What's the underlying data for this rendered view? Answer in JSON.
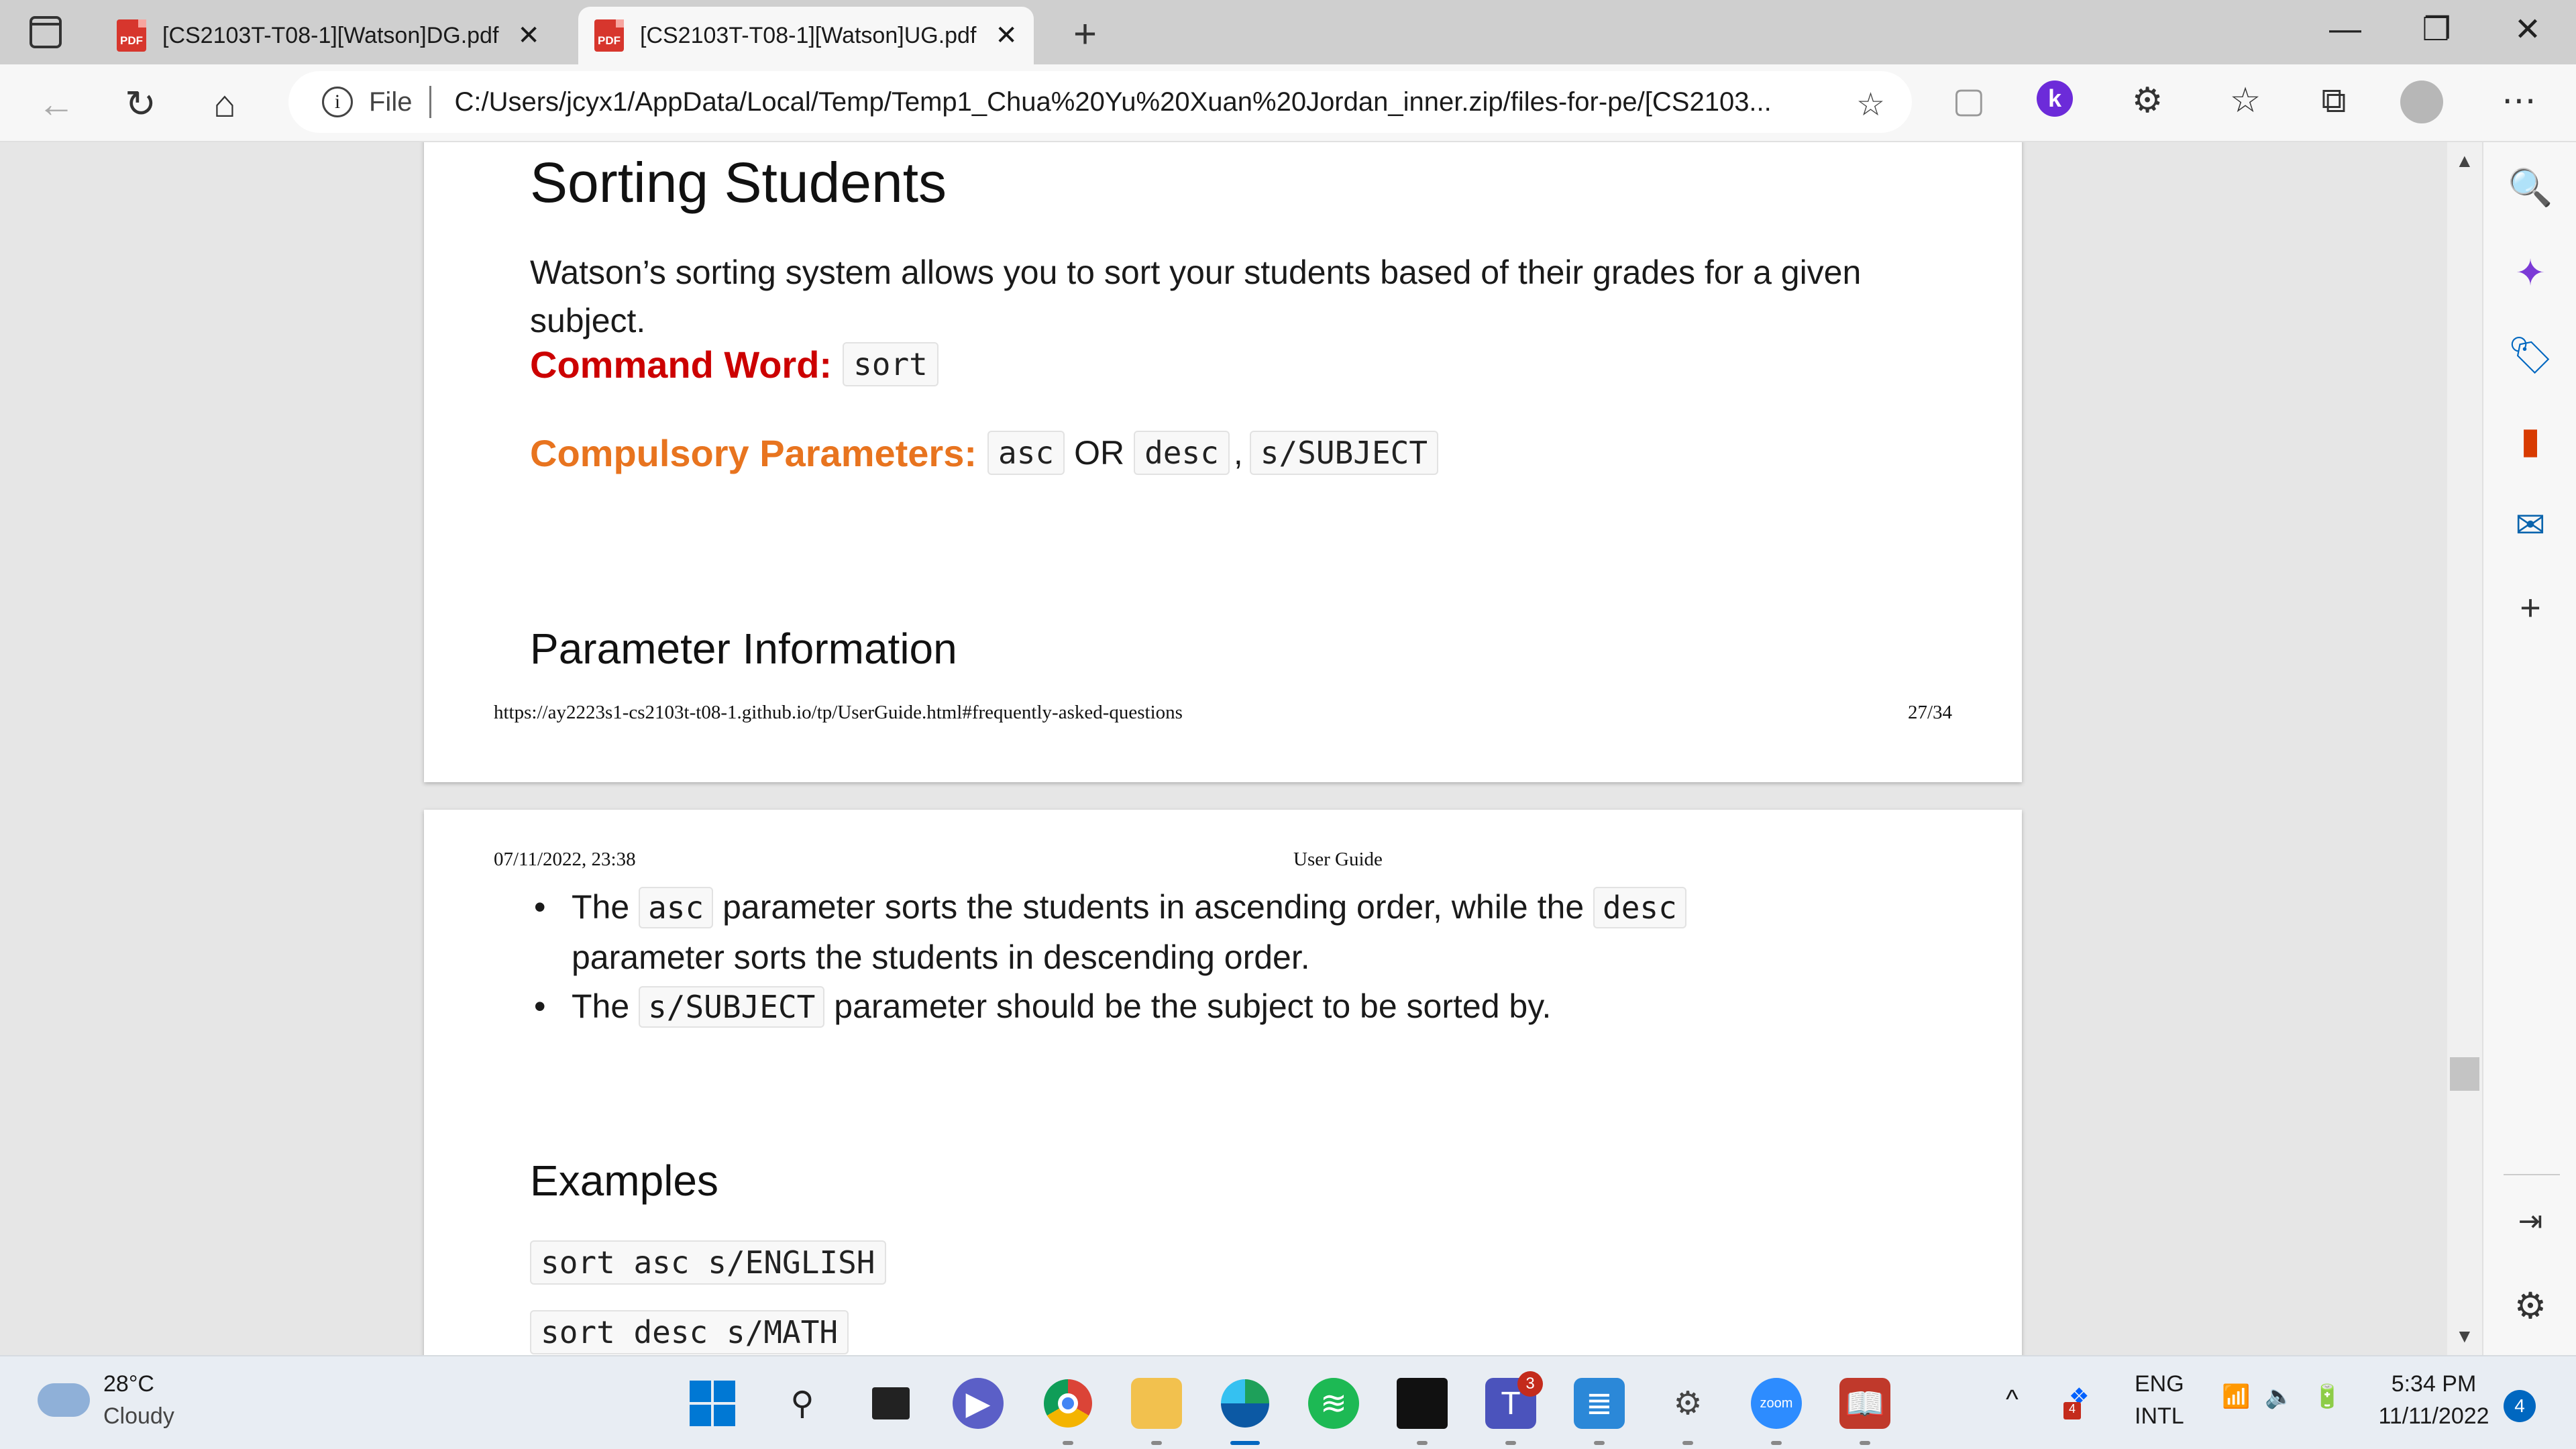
{
  "tabs": [
    {
      "label": "[CS2103T-T08-1][Watson]DG.pdf",
      "icon": "pdf-icon",
      "active": false
    },
    {
      "label": "[CS2103T-T08-1][Watson]UG.pdf",
      "icon": "pdf-icon",
      "active": true
    }
  ],
  "address": {
    "scheme_label": "File",
    "url": "C:/Users/jcyx1/AppData/Local/Temp/Temp1_Chua%20Yu%20Xuan%20Jordan_inner.zip/files-for-pe/[CS2103..."
  },
  "pdf_icon_text": "PDF",
  "extension_k": "k",
  "page27": {
    "title": "Sorting Students",
    "intro": "Watson’s sorting system allows you to sort your students based of their grades for a given subject.",
    "command_label": "Command Word:",
    "command_value": "sort",
    "params_label": "Compulsory Parameters:",
    "param_asc": "asc",
    "param_or": "OR",
    "param_desc": "desc",
    "param_comma": ",",
    "param_subject": "s/SUBJECT",
    "section_title": "Parameter Information",
    "footer_url": "https://ay2223s1-cs2103t-t08-1.github.io/tp/UserGuide.html#frequently-asked-questions",
    "page_number": "27/34"
  },
  "page28": {
    "header_date": "07/11/2022, 23:38",
    "header_title": "User Guide",
    "bullet1_pre": "The",
    "bullet1_code1": "asc",
    "bullet1_mid": "parameter sorts the students in ascending order, while the",
    "bullet1_code2": "desc",
    "bullet1_post": "parameter sorts the students in descending order.",
    "bullet2_pre": "The",
    "bullet2_code": "s/SUBJECT",
    "bullet2_post": "parameter should be the subject to be sorted by.",
    "examples_title": "Examples",
    "example1": "sort asc s/ENGLISH",
    "example2": "sort desc s/MATH"
  },
  "taskbar": {
    "weather_temp": "28°C",
    "weather_cond": "Cloudy",
    "lang": "ENG",
    "layout": "INTL",
    "time": "5:34 PM",
    "date": "11/11/2022",
    "notifications": "4",
    "teams_badge": "3",
    "dropbox_badge": "4",
    "zoom_label": "zoom"
  },
  "colors": {
    "command_word": "#cc0000",
    "compulsory_params": "#e8741f",
    "accent": "#0067c0"
  }
}
